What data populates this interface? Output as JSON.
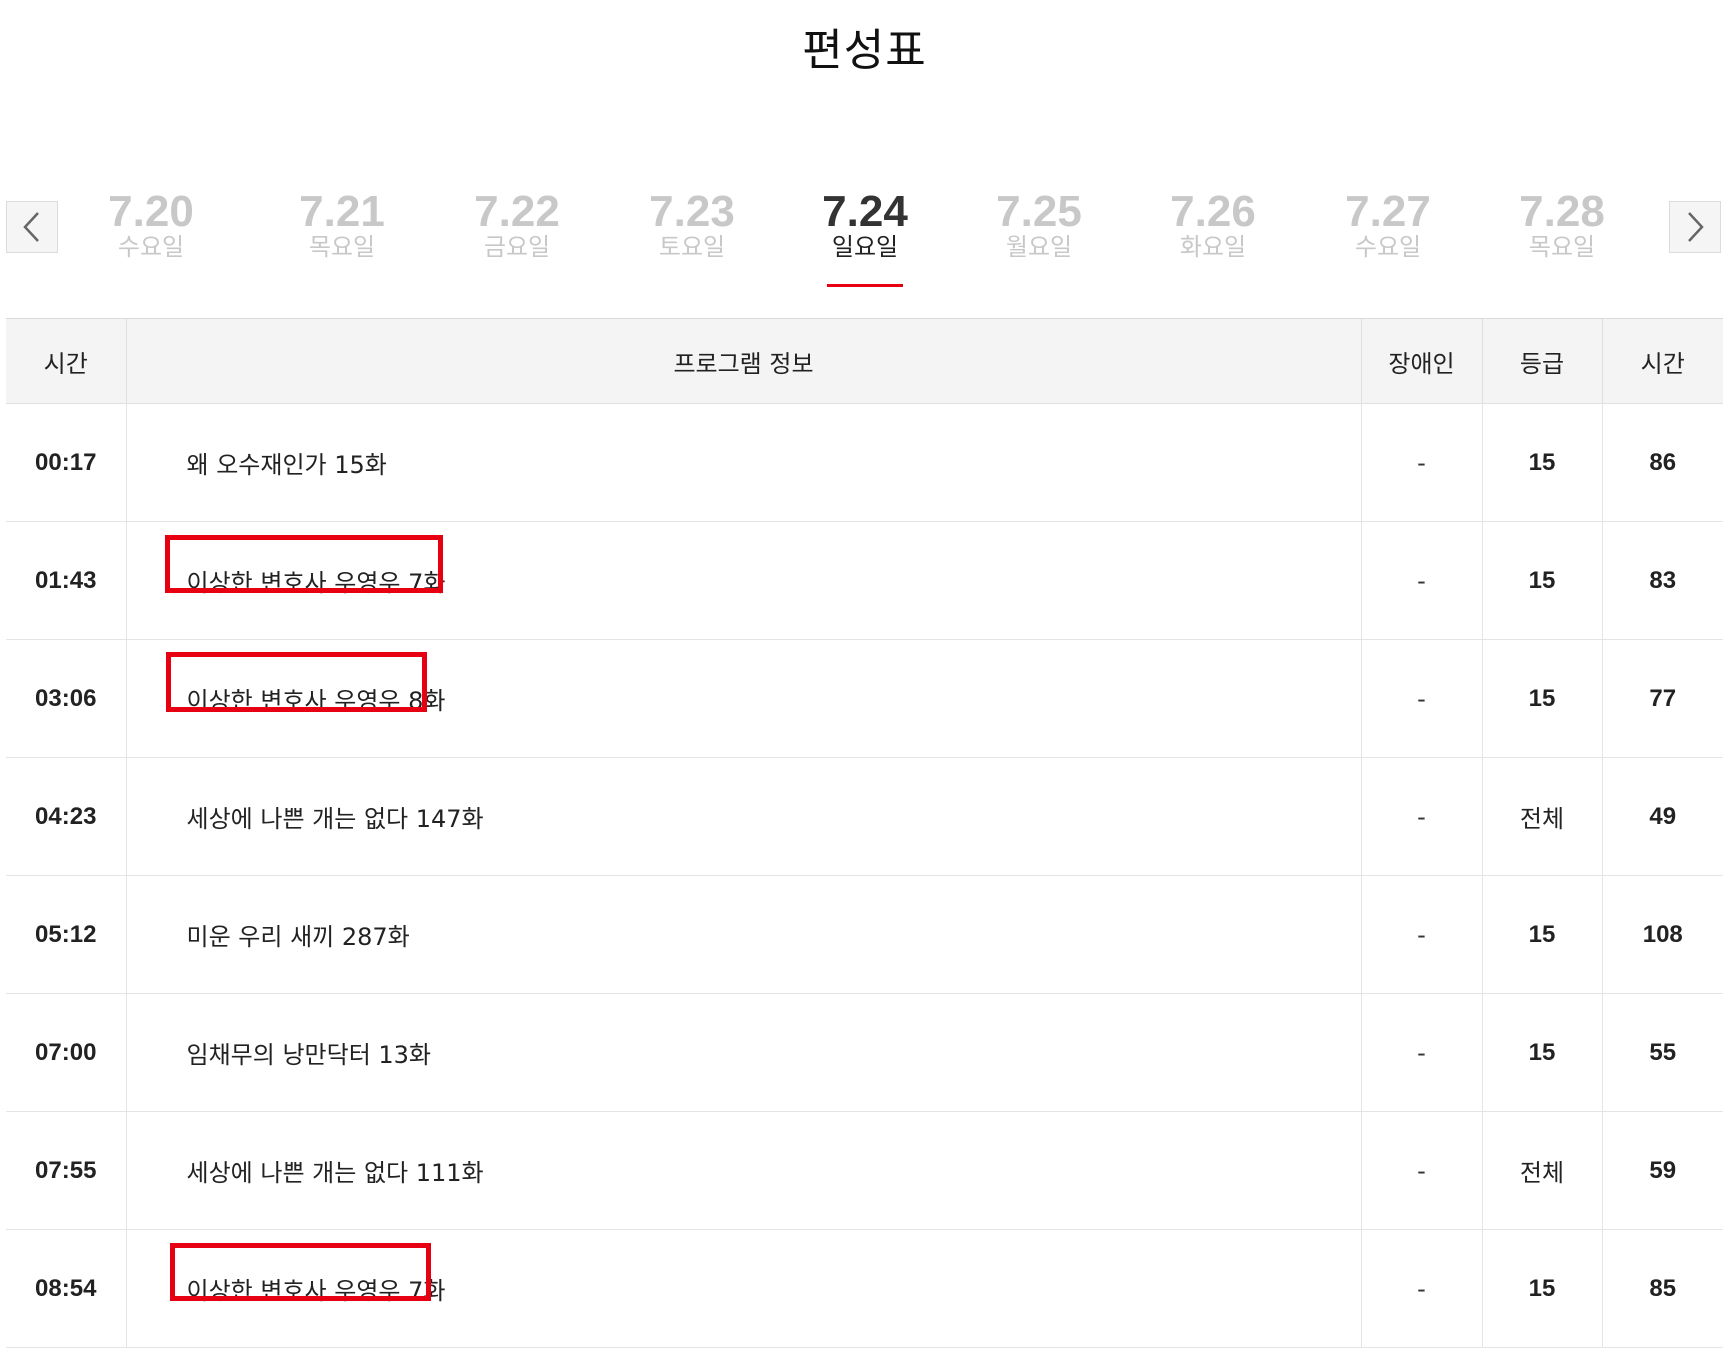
{
  "page": {
    "title": "편성표"
  },
  "nav": {
    "prev_icon": "chevron-left-icon",
    "next_icon": "chevron-right-icon"
  },
  "dates": [
    {
      "date": "7.20",
      "day": "수요일",
      "active": false
    },
    {
      "date": "7.21",
      "day": "목요일",
      "active": false
    },
    {
      "date": "7.22",
      "day": "금요일",
      "active": false
    },
    {
      "date": "7.23",
      "day": "토요일",
      "active": false
    },
    {
      "date": "7.24",
      "day": "일요일",
      "active": true
    },
    {
      "date": "7.25",
      "day": "월요일",
      "active": false
    },
    {
      "date": "7.26",
      "day": "화요일",
      "active": false
    },
    {
      "date": "7.27",
      "day": "수요일",
      "active": false
    },
    {
      "date": "7.28",
      "day": "목요일",
      "active": false
    }
  ],
  "table": {
    "headers": {
      "time": "시간",
      "program": "프로그램 정보",
      "accessibility": "장애인",
      "rating": "등급",
      "duration": "시간"
    },
    "rows": [
      {
        "time": "00:17",
        "program": "왜 오수재인가 15화",
        "accessibility": "-",
        "rating": "15",
        "duration": "86",
        "highlighted": false
      },
      {
        "time": "01:43",
        "program": "이상한 변호사 우영우 7화",
        "accessibility": "-",
        "rating": "15",
        "duration": "83",
        "highlighted": true
      },
      {
        "time": "03:06",
        "program": "이상한 변호사 우영우 8화",
        "accessibility": "-",
        "rating": "15",
        "duration": "77",
        "highlighted": true
      },
      {
        "time": "04:23",
        "program": "세상에 나쁜 개는 없다 147화",
        "accessibility": "-",
        "rating": "전체",
        "duration": "49",
        "highlighted": false
      },
      {
        "time": "05:12",
        "program": "미운 우리 새끼 287화",
        "accessibility": "-",
        "rating": "15",
        "duration": "108",
        "highlighted": false
      },
      {
        "time": "07:00",
        "program": "임채무의 낭만닥터 13화",
        "accessibility": "-",
        "rating": "15",
        "duration": "55",
        "highlighted": false
      },
      {
        "time": "07:55",
        "program": "세상에 나쁜 개는 없다 111화",
        "accessibility": "-",
        "rating": "전체",
        "duration": "59",
        "highlighted": false
      },
      {
        "time": "08:54",
        "program": "이상한 변호사 우영우 7화",
        "accessibility": "-",
        "rating": "15",
        "duration": "85",
        "highlighted": true
      }
    ]
  },
  "colors": {
    "accent": "#e60012",
    "inactive_date": "#c8c8c8",
    "header_bg": "#f4f4f4"
  }
}
